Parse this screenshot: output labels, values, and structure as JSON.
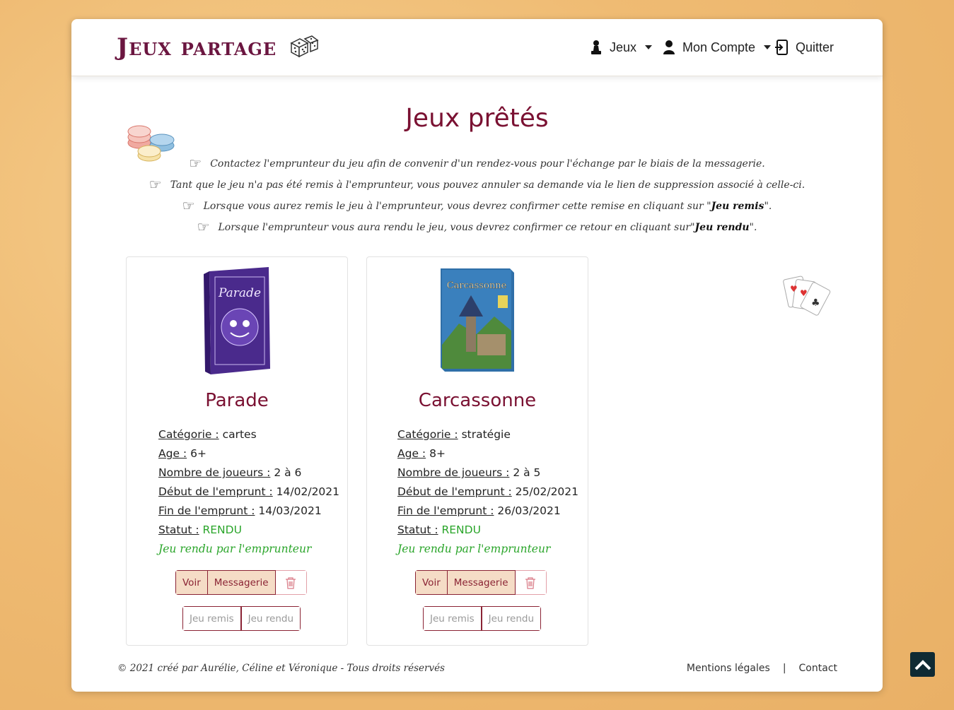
{
  "brand": {
    "name": "Jeux partage"
  },
  "nav": {
    "jeux": "Jeux",
    "compte": "Mon Compte",
    "quitter": "Quitter"
  },
  "page": {
    "title": "Jeux prêtés",
    "info": [
      "Contactez l'emprunteur du jeu afin de convenir d'un rendez-vous pour l'échange par le biais de la messagerie.",
      "Tant que le jeu n'a pas été remis à l'emprunteur, vous pouvez annuler sa demande via le lien de suppression associé à celle-ci.",
      {
        "before": "Lorsque vous aurez remis le jeu à l'emprunteur, vous devrez confirmer cette remise en cliquant sur \"",
        "bold": "Jeu remis",
        "after": "\"."
      },
      {
        "before": "Lorsque l'emprunteur vous aura rendu le jeu, vous devrez confirmer ce retour en cliquant sur\"",
        "bold": "Jeu rendu",
        "after": "\"."
      }
    ]
  },
  "labels": {
    "categorie": "Catégorie :",
    "age": "Age :",
    "joueurs": "Nombre de joueurs :",
    "debut": "Début de l'emprunt :",
    "fin": "Fin de l'emprunt :",
    "statut": "Statut :",
    "voir": "Voir",
    "messagerie": "Messagerie",
    "jeu_remis": "Jeu remis",
    "jeu_rendu": "Jeu rendu"
  },
  "games": [
    {
      "name": "Parade",
      "cover_text": "Parade",
      "categorie": "cartes",
      "age": "6+",
      "joueurs": "2 à 6",
      "debut": "14/02/2021",
      "fin": "14/03/2021",
      "statut": "RENDU",
      "note": "Jeu rendu par l'emprunteur"
    },
    {
      "name": "Carcassonne",
      "cover_text": "Carcassonne",
      "categorie": "stratégie",
      "age": "8+",
      "joueurs": "2 à 5",
      "debut": "25/02/2021",
      "fin": "26/03/2021",
      "statut": "RENDU",
      "note": "Jeu rendu par l'emprunteur"
    }
  ],
  "footer": {
    "copyright": "© 2021 créé par Aurélie, Céline et Véronique - Tous droits réservés",
    "mentions": "Mentions légales",
    "separator": "|",
    "contact": "Contact"
  },
  "colors": {
    "accent": "#7a1132",
    "status_green": "#2aa52a",
    "button_fill": "#f5dcc6",
    "scroll_top_bg": "#0f2a33"
  }
}
